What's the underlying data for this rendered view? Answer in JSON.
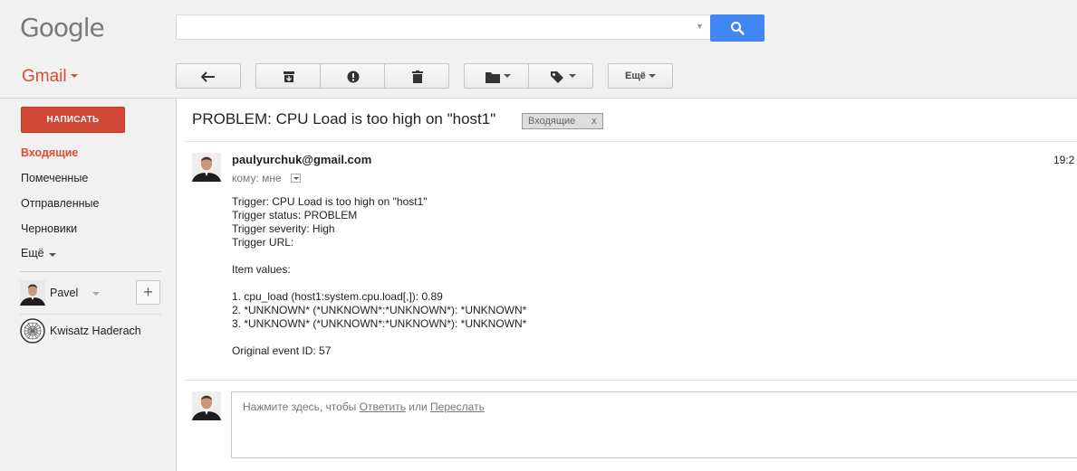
{
  "header": {
    "logo": "Google",
    "search_value": ""
  },
  "gmail": {
    "label": "Gmail"
  },
  "toolbar": {
    "more_label": "Ещё"
  },
  "sidebar": {
    "compose_label": "НАПИСАТЬ",
    "items": [
      {
        "label": "Входящие",
        "active": true
      },
      {
        "label": "Помеченные"
      },
      {
        "label": "Отправленные"
      },
      {
        "label": "Черновики"
      },
      {
        "label": "Ещё"
      }
    ],
    "contacts": [
      {
        "name": "Pavel"
      },
      {
        "name": "Kwisatz Haderach"
      }
    ],
    "add_contact": "+"
  },
  "message": {
    "subject": "PROBLEM: CPU Load is too high on \"host1\"",
    "label_chip": "Входящие",
    "label_chip_close": "x",
    "sender": "paulyurchuk@gmail.com",
    "time": "19:2",
    "to_line": "кому: мне",
    "body_lines": [
      "Trigger: CPU Load is too high on \"host1\"",
      "Trigger status: PROBLEM",
      "Trigger severity: High",
      "Trigger URL:",
      "",
      "Item values:",
      "",
      "1. cpu_load (host1:system.cpu.load[,]): 0.89",
      "2. *UNKNOWN* (*UNKNOWN*:*UNKNOWN*): *UNKNOWN*",
      "3. *UNKNOWN* (*UNKNOWN*:*UNKNOWN*): *UNKNOWN*",
      "",
      "Original event ID: 57"
    ]
  },
  "reply": {
    "prefix": "Нажмите здесь, чтобы ",
    "reply_link": "Ответить",
    "middle": " или ",
    "forward_link": "Переслать"
  },
  "colors": {
    "brand_red": "#dd4b39",
    "search_blue": "#4285f4",
    "compose_red": "#d14836"
  }
}
